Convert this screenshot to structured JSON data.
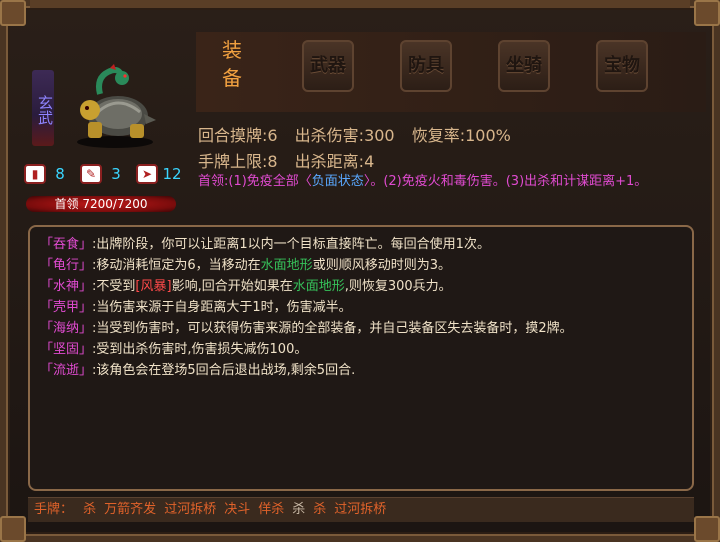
{
  "character": {
    "name": "玄武",
    "hp_label": "首领 7200/7200",
    "hp_fraction": 1.0,
    "stats": [
      {
        "icon": "hand-card-icon",
        "value": "8"
      },
      {
        "icon": "attack-icon",
        "value": "3"
      },
      {
        "icon": "speed-icon",
        "value": "12"
      }
    ]
  },
  "tabs": {
    "active": "装\n备",
    "items": [
      "武器",
      "防具",
      "坐骑",
      "宝物"
    ]
  },
  "info": {
    "row1": [
      "回合摸牌:6",
      "出杀伤害:300",
      "恢复率:100%"
    ],
    "row2": [
      "手牌上限:8",
      "出杀距离:4"
    ],
    "trait_prefix": "首领:(1)免疫全部〈",
    "trait_blue": "负面状态",
    "trait_suffix": "〉。(2)免疫火和毒伤害。(3)出杀和计谋距离+1。"
  },
  "skills": [
    {
      "kw": "「吞食」",
      "parts": [
        {
          "t": ":出牌阶段，你可以让距离1以内一个目标直接阵亡。每回合使用1次。",
          "c": ""
        }
      ]
    },
    {
      "kw": "「龟行」",
      "parts": [
        {
          "t": ":移动消耗恒定为6，当移动在",
          "c": ""
        },
        {
          "t": "水面地形",
          "c": "g"
        },
        {
          "t": "或则顺风移动时则为3。",
          "c": ""
        }
      ]
    },
    {
      "kw": "「水神」",
      "parts": [
        {
          "t": ":不受到",
          "c": ""
        },
        {
          "t": "[风暴]",
          "c": "r"
        },
        {
          "t": "影响,回合开始如果在",
          "c": ""
        },
        {
          "t": "水面地形",
          "c": "g"
        },
        {
          "t": ",则恢复300兵力。",
          "c": ""
        }
      ]
    },
    {
      "kw": "「壳甲」",
      "parts": [
        {
          "t": ":当伤害来源于自身距离大于1时，伤害减半。",
          "c": ""
        }
      ]
    },
    {
      "kw": "「海纳」",
      "parts": [
        {
          "t": ":当受到伤害时，可以获得伤害来源的全部装备，并自己装备区失去装备时，摸2牌。",
          "c": ""
        }
      ]
    },
    {
      "kw": "「坚固」",
      "parts": [
        {
          "t": ":受到出杀伤害时,伤害损失减伤100。",
          "c": ""
        }
      ]
    },
    {
      "kw": "「流逝」",
      "parts": [
        {
          "t": ":该角色会在登场5回合后退出战场,剩余5回合.",
          "c": ""
        }
      ]
    }
  ],
  "hand": {
    "label": "手牌：",
    "cards": [
      {
        "t": "杀",
        "alt": false
      },
      {
        "t": "万箭齐发",
        "alt": false
      },
      {
        "t": "过河拆桥",
        "alt": false
      },
      {
        "t": "决斗",
        "alt": false
      },
      {
        "t": "佯杀",
        "alt": false
      },
      {
        "t": "杀",
        "alt": true
      },
      {
        "t": "杀",
        "alt": false
      },
      {
        "t": "过河拆桥",
        "alt": false
      }
    ]
  },
  "colors": {
    "accent": "#f0a040",
    "skill_keyword": "#e04bd0",
    "terrain": "#36c25a",
    "hp": "#c01818",
    "stat": "#3ad6ff"
  }
}
